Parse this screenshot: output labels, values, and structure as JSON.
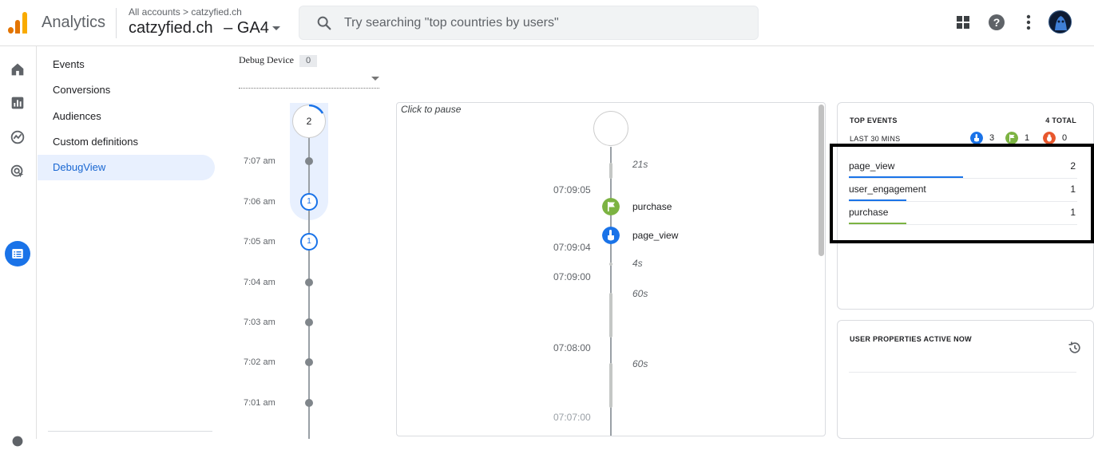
{
  "header": {
    "app_name": "Analytics",
    "breadcrumb": "All accounts > catzyfied.ch",
    "property": "catzyfied.ch",
    "property_suffix": "– GA4",
    "search_placeholder": "Try searching \"top countries by users\"",
    "icons": [
      "apps-grid-icon",
      "help-icon",
      "more-vert-icon",
      "avatar"
    ]
  },
  "rail": {
    "icons": [
      "home-icon",
      "reports-icon",
      "explore-icon",
      "advertising-icon",
      "configure-icon",
      "settings-icon"
    ]
  },
  "sidenav": {
    "items": [
      {
        "label": "Events"
      },
      {
        "label": "Conversions"
      },
      {
        "label": "Audiences"
      },
      {
        "label": "Custom definitions"
      },
      {
        "label": "DebugView",
        "active": true
      }
    ]
  },
  "debug": {
    "device_label": "Debug Device",
    "device_count": "0"
  },
  "minutes": {
    "top_count": "2",
    "rows": [
      {
        "time": "7:07 am",
        "count": null
      },
      {
        "time": "7:06 am",
        "count": "1"
      },
      {
        "time": "7:05 am",
        "count": "1"
      },
      {
        "time": "7:04 am",
        "count": null
      },
      {
        "time": "7:03 am",
        "count": null
      },
      {
        "time": "7:02 am",
        "count": null
      },
      {
        "time": "7:01 am",
        "count": null
      }
    ]
  },
  "stream": {
    "pause_label": "Click to pause",
    "times": [
      "07:09:05",
      "07:09:04",
      "07:09:00",
      "07:08:00",
      "07:07:00"
    ],
    "durations": [
      "21s",
      "4s",
      "60s",
      "60s"
    ],
    "events": [
      {
        "name": "purchase",
        "icon": "flag-icon",
        "color": "#7cb342"
      },
      {
        "name": "page_view",
        "icon": "touch-icon",
        "color": "#1a73e8"
      }
    ]
  },
  "top_events": {
    "title": "TOP EVENTS",
    "total": "4 TOTAL",
    "period": "LAST 30 MINS",
    "badges": [
      {
        "icon": "touch-icon",
        "count": "3",
        "color": "#1a73e8"
      },
      {
        "icon": "flag-icon",
        "count": "1",
        "color": "#7cb342"
      },
      {
        "icon": "bug-icon",
        "count": "0",
        "color": "#e8572d"
      }
    ],
    "rows": [
      {
        "label": "page_view",
        "value": "2",
        "bar_color": "#1a73e8",
        "bar_fraction": 0.5
      },
      {
        "label": "user_engagement",
        "value": "1",
        "bar_color": "#1a73e8",
        "bar_fraction": 0.25
      },
      {
        "label": "purchase",
        "value": "1",
        "bar_color": "#7cb342",
        "bar_fraction": 0.25
      }
    ]
  },
  "user_properties": {
    "title": "USER PROPERTIES ACTIVE NOW"
  }
}
